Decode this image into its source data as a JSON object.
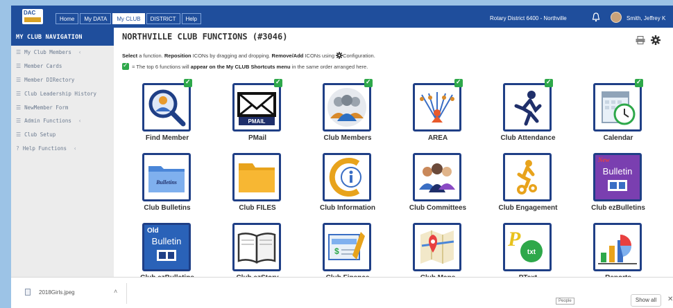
{
  "header": {
    "logo_text": "DAC",
    "tabs": [
      {
        "label": "Home",
        "active": false
      },
      {
        "label": "My DATA",
        "active": false
      },
      {
        "label": "My CLUB",
        "active": true
      },
      {
        "label": "DISTRICT",
        "active": false
      },
      {
        "label": "Help",
        "active": false
      }
    ],
    "district": "Rotary District 6400 - Northville",
    "user_name": "Smith, Jeffrey K",
    "bell_icon": "bell-icon"
  },
  "sidebar": {
    "title": "MY CLUB NAVIGATION",
    "items": [
      {
        "icon": "☰",
        "label": "My Club Members",
        "chevron": "‹"
      },
      {
        "icon": "☰",
        "label": "Member Cards",
        "chevron": ""
      },
      {
        "icon": "☰",
        "label": "Member DIRectory",
        "chevron": ""
      },
      {
        "icon": "☰",
        "label": "Club Leadership History",
        "chevron": ""
      },
      {
        "icon": "☰",
        "label": "NewMember Form",
        "chevron": ""
      },
      {
        "icon": "☰",
        "label": "Admin Functions",
        "chevron": "‹"
      },
      {
        "icon": "☰",
        "label": "Club Setup",
        "chevron": ""
      },
      {
        "icon": "?",
        "label": "Help Functions",
        "chevron": "‹"
      }
    ]
  },
  "main": {
    "title": "NORTHVILLE CLUB FUNCTIONS (#3046)",
    "instructions": {
      "select": "Select",
      "t1": " a function. ",
      "reposition": "Reposition",
      "t2": " ICONs by dragging and dropping. ",
      "removeadd": "Remove/Add",
      "t3": " ICONs using ",
      "t4": "Configuration.",
      "line2a": " = The top 6 functions will ",
      "line2b": "appear on the My CLUB Shortcuts menu",
      "line2c": " in the same order arranged here."
    },
    "functions": [
      {
        "label": "Find Member",
        "icon": "find-member-icon",
        "shortcut": true
      },
      {
        "label": "PMail",
        "icon": "pmail-icon",
        "shortcut": true,
        "icon_text": "PMAIL"
      },
      {
        "label": "Club Members",
        "icon": "club-members-icon",
        "shortcut": true
      },
      {
        "label": "AREA",
        "icon": "area-icon",
        "shortcut": true
      },
      {
        "label": "Club Attendance",
        "icon": "club-attendance-icon",
        "shortcut": true
      },
      {
        "label": "Calendar",
        "icon": "calendar-icon",
        "shortcut": true
      },
      {
        "label": "Club Bulletins",
        "icon": "club-bulletins-icon",
        "shortcut": false,
        "icon_text": "Bulletins"
      },
      {
        "label": "Club FILES",
        "icon": "club-files-icon",
        "shortcut": false
      },
      {
        "label": "Club Information",
        "icon": "club-information-icon",
        "shortcut": false
      },
      {
        "label": "Club Committees",
        "icon": "club-committees-icon",
        "shortcut": false
      },
      {
        "label": "Club Engagement",
        "icon": "club-engagement-icon",
        "shortcut": false
      },
      {
        "label": "Club ezBulletins",
        "icon": "club-ezbulletins-new-icon",
        "shortcut": false,
        "icon_text": "Bulletin",
        "icon_tag": "New"
      },
      {
        "label": "Club ezBulletins",
        "icon": "club-ezbulletins-old-icon",
        "shortcut": false,
        "icon_text": "Bulletin",
        "icon_tag": "Old"
      },
      {
        "label": "Club ezStory",
        "icon": "club-ezstory-icon",
        "shortcut": false
      },
      {
        "label": "Club Finance",
        "icon": "club-finance-icon",
        "shortcut": false
      },
      {
        "label": "Club Maps",
        "icon": "club-maps-icon",
        "shortcut": false
      },
      {
        "label": "PText",
        "icon": "ptext-icon",
        "shortcut": false,
        "icon_text": "txt"
      },
      {
        "label": "Reports",
        "icon": "reports-icon",
        "shortcut": false
      }
    ]
  },
  "download_bar": {
    "file_name": "2018Girls.jpeg",
    "show_all": "Show all",
    "close": "✕",
    "people_tooltip": "People"
  },
  "colors": {
    "primary": "#1f4e9c",
    "icon_border": "#1f3f86",
    "check_green": "#2ea84a",
    "background": "#9cc3e6"
  }
}
